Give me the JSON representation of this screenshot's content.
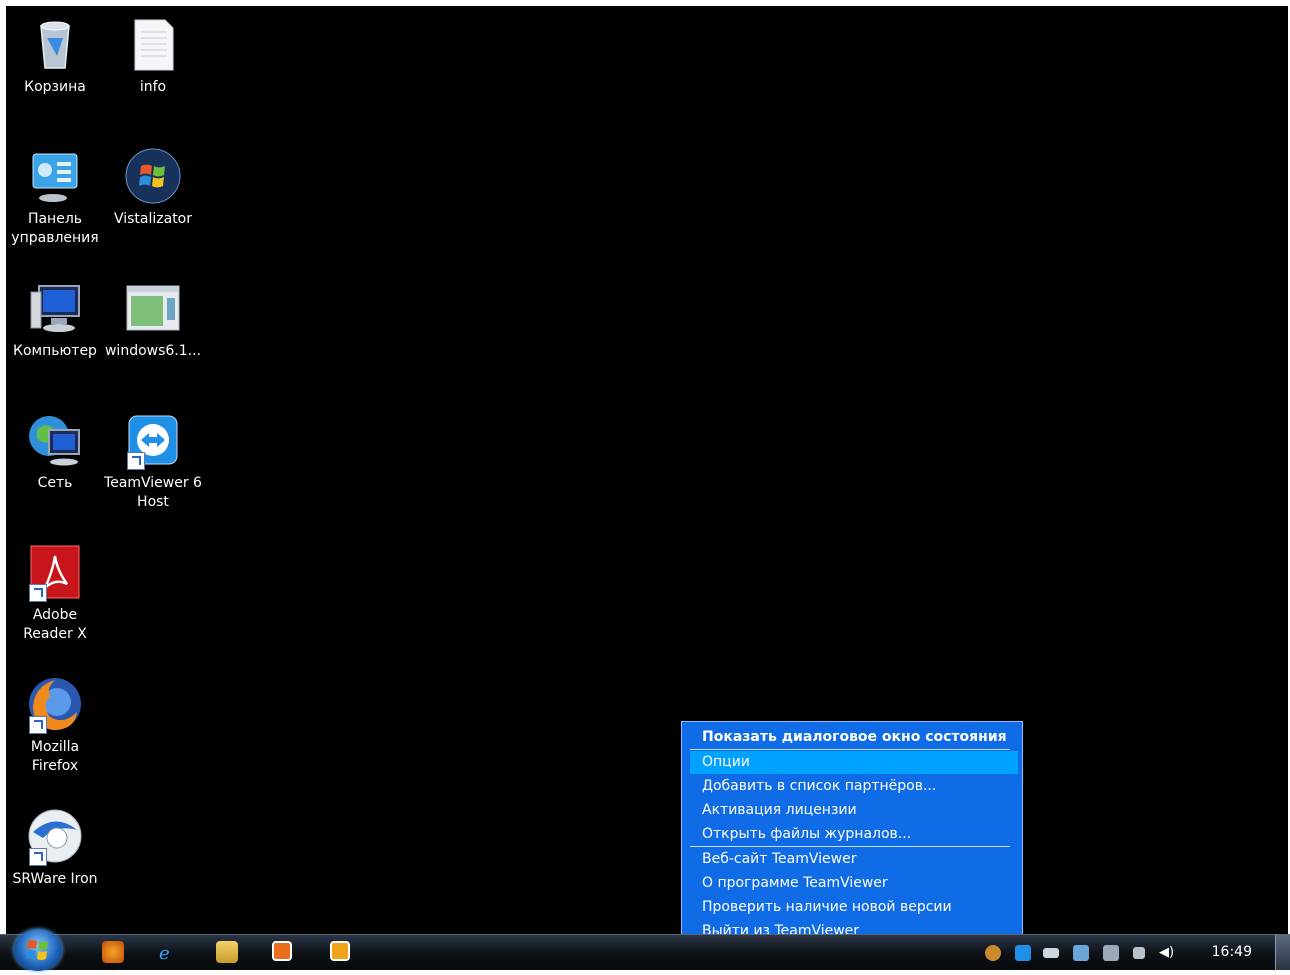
{
  "desktop_icons": [
    {
      "label": "Корзина",
      "icon": "recycle-bin-icon"
    },
    {
      "label": "info",
      "icon": "text-file-icon"
    },
    {
      "label": "Панель управления",
      "icon": "control-panel-icon"
    },
    {
      "label": "Vistalizator",
      "icon": "windows-logo-icon"
    },
    {
      "label": "Компьютер",
      "icon": "computer-icon"
    },
    {
      "label": "windows6.1...",
      "icon": "installer-file-icon"
    },
    {
      "label": "Сеть",
      "icon": "network-icon"
    },
    {
      "label": "TeamViewer 6 Host",
      "icon": "teamviewer-icon"
    },
    {
      "label": "Adobe Reader X",
      "icon": "adobe-reader-icon"
    },
    {
      "label": "Mozilla Firefox",
      "icon": "firefox-icon"
    },
    {
      "label": "SRWare Iron",
      "icon": "srware-iron-icon"
    }
  ],
  "taskbar": {
    "pinned": [
      "firefox-icon",
      "internet-explorer-icon",
      "file-explorer-icon",
      "media-player-icon",
      "outlook-icon"
    ],
    "tray_icons": [
      "tray-app-icon",
      "teamviewer-tray-icon",
      "drive-icon",
      "usb-safely-remove-icon",
      "vmware-icon",
      "network-tray-icon",
      "volume-icon"
    ],
    "clock": "16:49"
  },
  "context_menu": {
    "items": [
      {
        "label": "Показать диалоговое окно состояния",
        "bold": true
      },
      {
        "label": "Опции",
        "selected": true
      },
      {
        "label": "Добавить в список партнёров..."
      },
      {
        "label": "Активация лицензии"
      },
      {
        "label": "Открыть файлы журналов..."
      },
      {
        "label": "Веб-сайт TeamViewer"
      },
      {
        "label": "О программе TeamViewer"
      },
      {
        "label": "Проверить наличие новой версии"
      },
      {
        "label": "Выйти из TeamViewer"
      }
    ]
  },
  "colors": {
    "desktop": "#000000",
    "menu_bg": "#0f6ce6",
    "menu_selected": "#00a2ff"
  }
}
